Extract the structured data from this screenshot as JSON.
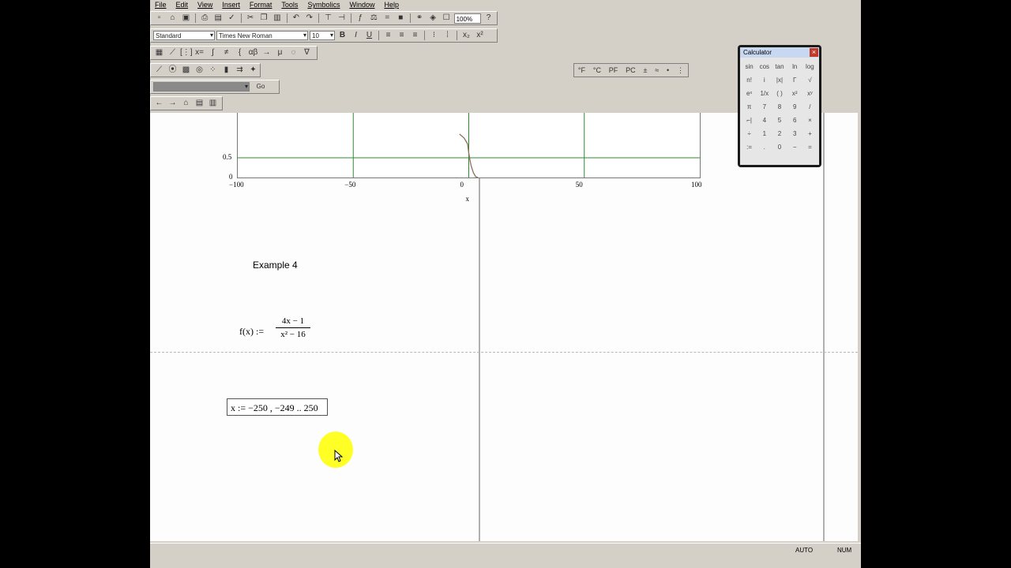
{
  "menu": [
    "File",
    "Edit",
    "View",
    "Insert",
    "Format",
    "Tools",
    "Symbolics",
    "Window",
    "Help"
  ],
  "toolbar": {
    "zoom": "100%",
    "style_combo": "Standard",
    "font_combo": "Times New Roman",
    "size_combo": "10",
    "resource_combo": "",
    "go_label": "Go"
  },
  "math_toolbar": [
    "°F",
    "°C",
    "PF",
    "PC",
    "±",
    "≈",
    "•",
    "⋮"
  ],
  "chart_data": {
    "type": "line",
    "x": [
      -100,
      -50,
      0,
      50,
      100
    ],
    "yticks": [
      0,
      0.5
    ],
    "xtick_labels": [
      "−100",
      "−50",
      "0",
      "50",
      "100"
    ],
    "ytick_labels": [
      "0",
      "0.5"
    ],
    "xlabel": "x",
    "grid": true,
    "series": [
      {
        "x": [
          -4,
          -2,
          -0.5,
          0,
          0.5,
          1,
          2,
          3,
          4
        ],
        "y": [
          1.1,
          1.0,
          0.85,
          0.62,
          0.45,
          0.3,
          0.12,
          0.02,
          0
        ]
      }
    ]
  },
  "doc": {
    "example_title": "Example 4",
    "func_lhs": "f(x) :=",
    "func_num": "4x − 1",
    "func_den": "x² − 16",
    "range_def": "x := −250 , −249 .. 250"
  },
  "calculator": {
    "title": "Calculator",
    "keys": [
      "sin",
      "cos",
      "tan",
      "ln",
      "log",
      "n!",
      "i",
      "|x|",
      "Γ",
      "√",
      "eˣ",
      "1/x",
      "( )",
      "x²",
      "xʸ",
      "π",
      "7",
      "8",
      "9",
      "/",
      "⌐|",
      "4",
      "5",
      "6",
      "×",
      "÷",
      "1",
      "2",
      "3",
      "+",
      ":=",
      ".",
      "0",
      "−",
      "="
    ]
  },
  "status": {
    "mode": "AUTO",
    "num": "NUM"
  }
}
